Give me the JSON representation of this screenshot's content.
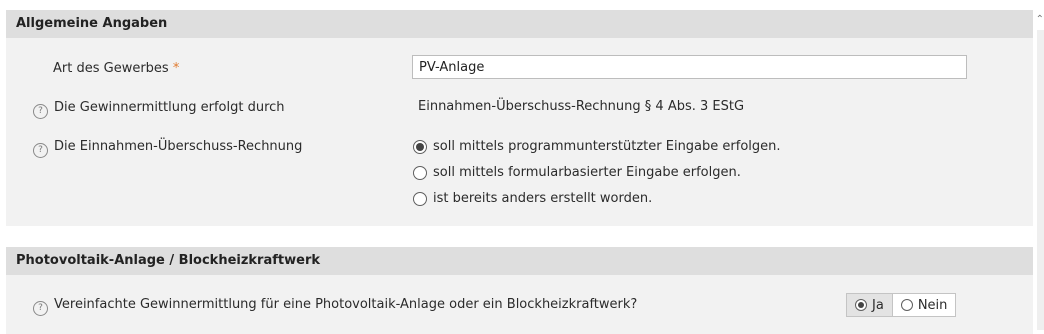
{
  "sections": {
    "general": {
      "title": "Allgemeine Angaben",
      "trade_label": "Art des Gewerbes",
      "required_mark": "*",
      "trade_value": "PV-Anlage",
      "profit_method_label": "Die Gewinnermittlung erfolgt durch",
      "profit_method_value": "Einnahmen-Überschuss-Rechnung § 4 Abs. 3 EStG",
      "eur_label": "Die Einnahmen-Überschuss-Rechnung",
      "eur_options": [
        {
          "label": "soll mittels programmunterstützter Eingabe erfolgen.",
          "selected": true
        },
        {
          "label": "soll mittels formularbasierter Eingabe erfolgen.",
          "selected": false
        },
        {
          "label": "ist bereits anders erstellt worden.",
          "selected": false
        }
      ]
    },
    "pv": {
      "title": "Photovoltaik-Anlage / Blockheizkraftwerk",
      "question": "Vereinfachte Gewinnermittlung für eine Photovoltaik-Anlage oder ein Blockheizkraftwerk?",
      "yes_label": "Ja",
      "no_label": "Nein",
      "selected": "Ja"
    }
  },
  "icons": {
    "help": "help-circle-icon",
    "scroll_up": "chevron-up-icon"
  },
  "colors": {
    "required": "#e07a2f",
    "header_bg": "#dedede",
    "section_bg": "#f2f2f2"
  }
}
